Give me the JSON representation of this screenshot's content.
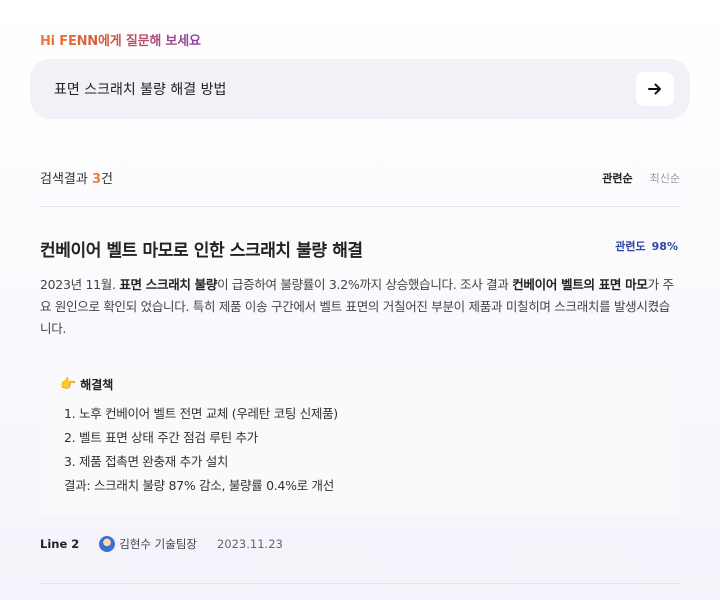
{
  "greeting": "Hi FENN에게 질문해 보세요",
  "search": {
    "value": "표면 스크래치 불량 해결 방법",
    "submit_icon": "arrow-right-icon"
  },
  "results": {
    "count_prefix": "검색결과 ",
    "count": "3",
    "count_suffix": "건",
    "sort": {
      "active": "관련순",
      "inactive": "최신순"
    }
  },
  "item": {
    "title": "컨베이어 벨트 마모로 인한 스크래치 불량 해결",
    "relevance_label": "관련도",
    "relevance_value": "98%",
    "summary": {
      "p1": "2023년 11월. ",
      "b1": "표면 스크래치 불량",
      "p2": "이 급증하여 불량률이 3.2%까지 상승했습니다. 조사 결과 ",
      "b2": "컨베이어 벨트의 표면 마모",
      "p3": "가 주요 원인으로 확인되 었습니다. 특히 제품 이송 구간에서 벨트 표면의 거칠어진 부분이 제품과 미칠히며 스크래치를 발생시켰습니다."
    },
    "solution": {
      "icon": "pointing-hand-icon",
      "heading": "해결책",
      "steps": [
        "1. 노후 컨베이어 벨트 전면 교체 (우레탄 코팅 신제품)",
        "2. 벨트 표면 상태 주간 점검 루틴 추가",
        "3. 제품 접촉면 완충재 추가 설치"
      ],
      "outcome": "결과: 스크래치 불량 87% 감소, 불량률 0.4%로 개선"
    },
    "meta": {
      "line": "Line 2",
      "author": "김현수 기술팀장",
      "date": "2023.11.23"
    }
  },
  "colors": {
    "accent_orange": "#f07a36",
    "relevance_blue": "#2e45a8"
  }
}
